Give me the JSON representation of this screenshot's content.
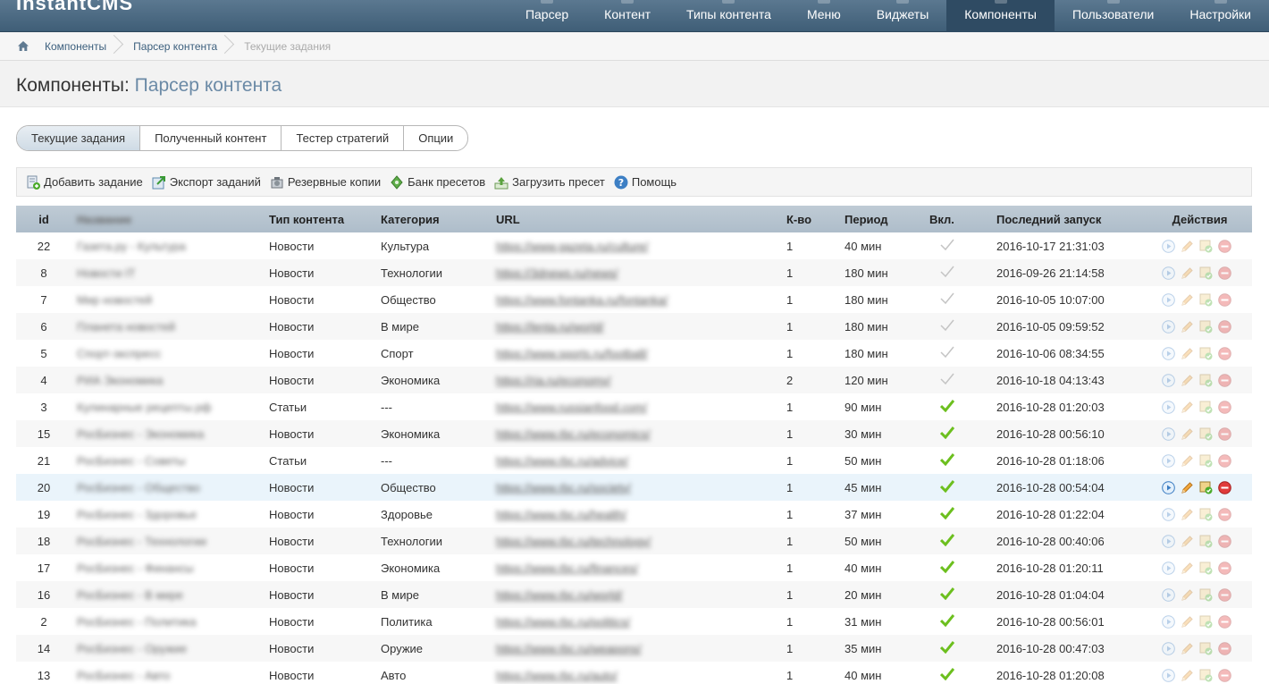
{
  "app": {
    "logo_main": "InstantCMS",
    "logo_accent": ""
  },
  "nav": [
    {
      "label": "Парсер"
    },
    {
      "label": "Контент"
    },
    {
      "label": "Типы контента"
    },
    {
      "label": "Меню"
    },
    {
      "label": "Виджеты"
    },
    {
      "label": "Компоненты",
      "active": true
    },
    {
      "label": "Пользователи"
    },
    {
      "label": "Настройки"
    }
  ],
  "breadcrumb": [
    "Компоненты",
    "Парсер контента",
    "Текущие задания"
  ],
  "page": {
    "title": "Компоненты:",
    "subtitle": "Парсер контента"
  },
  "tabs": [
    "Текущие задания",
    "Полученный контент",
    "Тестер стратегий",
    "Опции"
  ],
  "toolbar": {
    "add": "Добавить задание",
    "export": "Экспорт заданий",
    "backups": "Резервные копии",
    "presets": "Банк пресетов",
    "load_preset": "Загрузить пресет",
    "help": "Помощь"
  },
  "table": {
    "headers": {
      "id": "id",
      "name": "Название",
      "type": "Тип контента",
      "category": "Категория",
      "url": "URL",
      "count": "К-во",
      "period": "Период",
      "enabled": "Вкл.",
      "last_run": "Последний запуск",
      "actions": "Действия"
    },
    "rows": [
      {
        "id": "22",
        "name": "Газета.ру - Культура",
        "type": "Новости",
        "category": "Культура",
        "url": "https://www.gazeta.ru/culture/",
        "count": "1",
        "period": "40 мин",
        "enabled": false,
        "last_run": "2016-10-17 21:31:03"
      },
      {
        "id": "8",
        "name": "Новости IT",
        "type": "Новости",
        "category": "Технологии",
        "url": "https://3dnews.ru/news/",
        "count": "1",
        "period": "180 мин",
        "enabled": false,
        "last_run": "2016-09-26 21:14:58"
      },
      {
        "id": "7",
        "name": "Мир новостей",
        "type": "Новости",
        "category": "Общество",
        "url": "https://www.fontanka.ru/fontanka/",
        "count": "1",
        "period": "180 мин",
        "enabled": false,
        "last_run": "2016-10-05 10:07:00"
      },
      {
        "id": "6",
        "name": "Планета новостей",
        "type": "Новости",
        "category": "В мире",
        "url": "https://lenta.ru/world/",
        "count": "1",
        "period": "180 мин",
        "enabled": false,
        "last_run": "2016-10-05 09:59:52"
      },
      {
        "id": "5",
        "name": "Спорт-экспресс",
        "type": "Новости",
        "category": "Спорт",
        "url": "https://www.sports.ru/football/",
        "count": "1",
        "period": "180 мин",
        "enabled": false,
        "last_run": "2016-10-06 08:34:55"
      },
      {
        "id": "4",
        "name": "РИА Экономика",
        "type": "Новости",
        "category": "Экономика",
        "url": "https://ria.ru/economy/",
        "count": "2",
        "period": "120 мин",
        "enabled": false,
        "last_run": "2016-10-18 04:13:43"
      },
      {
        "id": "3",
        "name": "Кулинарные рецепты.рф",
        "type": "Статьи",
        "category": "---",
        "url": "https://www.russianfood.com/",
        "count": "1",
        "period": "90 мин",
        "enabled": true,
        "last_run": "2016-10-28 01:20:03"
      },
      {
        "id": "15",
        "name": "РосБизнес - Экономика",
        "type": "Новости",
        "category": "Экономика",
        "url": "https://www.rbc.ru/economics/",
        "count": "1",
        "period": "30 мин",
        "enabled": true,
        "last_run": "2016-10-28 00:56:10"
      },
      {
        "id": "21",
        "name": "РосБизнес - Советы",
        "type": "Статьи",
        "category": "---",
        "url": "https://www.rbc.ru/advice/",
        "count": "1",
        "period": "50 мин",
        "enabled": true,
        "last_run": "2016-10-28 01:18:06"
      },
      {
        "id": "20",
        "name": "РосБизнес - Общество",
        "type": "Новости",
        "category": "Общество",
        "url": "https://www.rbc.ru/society/",
        "count": "1",
        "period": "45 мин",
        "enabled": true,
        "last_run": "2016-10-28 00:54:04",
        "highlight": true
      },
      {
        "id": "19",
        "name": "РосБизнес - Здоровье",
        "type": "Новости",
        "category": "Здоровье",
        "url": "https://www.rbc.ru/health/",
        "count": "1",
        "period": "37 мин",
        "enabled": true,
        "last_run": "2016-10-28 01:22:04"
      },
      {
        "id": "18",
        "name": "РосБизнес - Технологии",
        "type": "Новости",
        "category": "Технологии",
        "url": "https://www.rbc.ru/technology/",
        "count": "1",
        "period": "50 мин",
        "enabled": true,
        "last_run": "2016-10-28 00:40:06"
      },
      {
        "id": "17",
        "name": "РосБизнес - Финансы",
        "type": "Новости",
        "category": "Экономика",
        "url": "https://www.rbc.ru/finances/",
        "count": "1",
        "period": "40 мин",
        "enabled": true,
        "last_run": "2016-10-28 01:20:11"
      },
      {
        "id": "16",
        "name": "РосБизнес - В мире",
        "type": "Новости",
        "category": "В мире",
        "url": "https://www.rbc.ru/world/",
        "count": "1",
        "period": "20 мин",
        "enabled": true,
        "last_run": "2016-10-28 01:04:04"
      },
      {
        "id": "2",
        "name": "РосБизнес - Политика",
        "type": "Новости",
        "category": "Политика",
        "url": "https://www.rbc.ru/politics/",
        "count": "1",
        "period": "31 мин",
        "enabled": true,
        "last_run": "2016-10-28 00:56:01"
      },
      {
        "id": "14",
        "name": "РосБизнес - Оружие",
        "type": "Новости",
        "category": "Оружие",
        "url": "https://www.rbc.ru/weapons/",
        "count": "1",
        "period": "35 мин",
        "enabled": true,
        "last_run": "2016-10-28 00:47:03"
      },
      {
        "id": "13",
        "name": "РосБизнес - Авто",
        "type": "Новости",
        "category": "Авто",
        "url": "https://www.rbc.ru/auto/",
        "count": "1",
        "period": "40 мин",
        "enabled": true,
        "last_run": "2016-10-28 01:20:08"
      }
    ]
  },
  "colors": {
    "nav_bg": "#4a6882",
    "nav_active": "#2f4b63",
    "check_on": "#6cbf1e",
    "check_off": "#b9b9b9",
    "link": "#3c5f7d"
  }
}
